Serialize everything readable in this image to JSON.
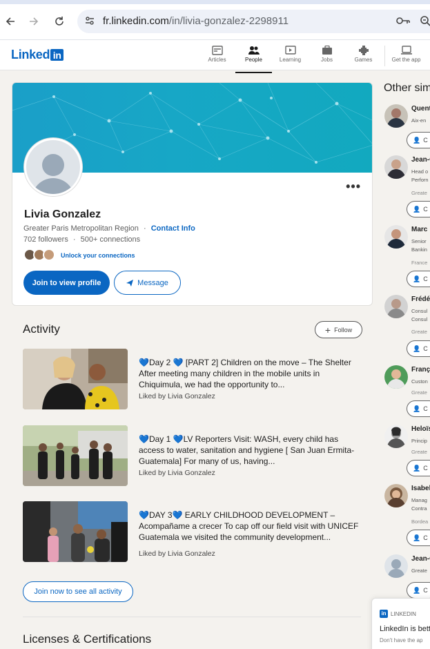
{
  "browser": {
    "url_host": "fr.linkedin.com",
    "url_path": "/in/livia-gonzalez-2298911"
  },
  "header": {
    "logo_text": "Linked",
    "logo_in": "in",
    "nav": [
      {
        "label": "Articles",
        "icon": "articles-icon"
      },
      {
        "label": "People",
        "icon": "people-icon",
        "active": true
      },
      {
        "label": "Learning",
        "icon": "learning-icon"
      },
      {
        "label": "Jobs",
        "icon": "jobs-icon"
      },
      {
        "label": "Games",
        "icon": "games-icon"
      },
      {
        "label": "Get the app",
        "icon": "get-app-icon"
      }
    ]
  },
  "profile": {
    "name": "Livia Gonzalez",
    "location": "Greater Paris Metropolitan Region",
    "separator": "·",
    "contact_info": "Contact Info",
    "followers": "702 followers",
    "connections": "500+ connections",
    "unlock": "Unlock your connections",
    "join_button": "Join to view profile",
    "message_button": "Message",
    "more": "•••"
  },
  "activity": {
    "title": "Activity",
    "follow_button": "Follow",
    "posts": [
      {
        "text": "💙Day 2 💙 [PART 2] Children on the move – The Shelter After meeting many children in the mobile units in Chiquimula, we had the opportunity to...",
        "liked": "Liked by Livia Gonzalez"
      },
      {
        "text": "💙Day 1 💙LV Reporters Visit: WASH, every child has access to water, sanitation and hygiene [ San Juan Ermita- Guatemala] For many of us, having...",
        "liked": "Liked by Livia Gonzalez"
      },
      {
        "text": "💙DAY 3💙 EARLY CHILDHOOD DEVELOPMENT – Acompañame a crecer To cap off our field visit with UNICEF Guatemala we visited the community development...",
        "liked": "Liked by Livia Gonzalez"
      }
    ],
    "see_all_button": "Join now to see all activity"
  },
  "licenses": {
    "title": "Licenses & Certifications"
  },
  "sidebar": {
    "title": "Other sim",
    "people": [
      {
        "name": "Quent",
        "sub1": "Aix-en",
        "sub2": "",
        "loc": "",
        "connect": "C"
      },
      {
        "name": "Jean-C",
        "sub1": "Head o",
        "sub2": "Perforn",
        "loc": "Greate",
        "connect": "C"
      },
      {
        "name": "Marc",
        "sub1": "Senior",
        "sub2": "Bankin",
        "loc": "France",
        "connect": "C"
      },
      {
        "name": "Frédé",
        "sub1": "Consul",
        "sub2": "Consul",
        "loc": "Greate",
        "connect": "C"
      },
      {
        "name": "Franç",
        "sub1": "Custon",
        "sub2": "",
        "loc": "Greate",
        "connect": "C"
      },
      {
        "name": "Heloïs",
        "sub1": "Princip",
        "sub2": "",
        "loc": "Greate",
        "connect": "C"
      },
      {
        "name": "Isabel",
        "sub1": "Manag",
        "sub2": "Contra",
        "loc": "Bordea",
        "connect": "C"
      },
      {
        "name": "Jean-C",
        "sub1": "Greate",
        "sub2": "",
        "loc": "",
        "connect": "C"
      }
    ]
  },
  "popup": {
    "brand": "LINKEDIN",
    "text": "LinkedIn is bett",
    "sub": "Don't have the ap"
  }
}
